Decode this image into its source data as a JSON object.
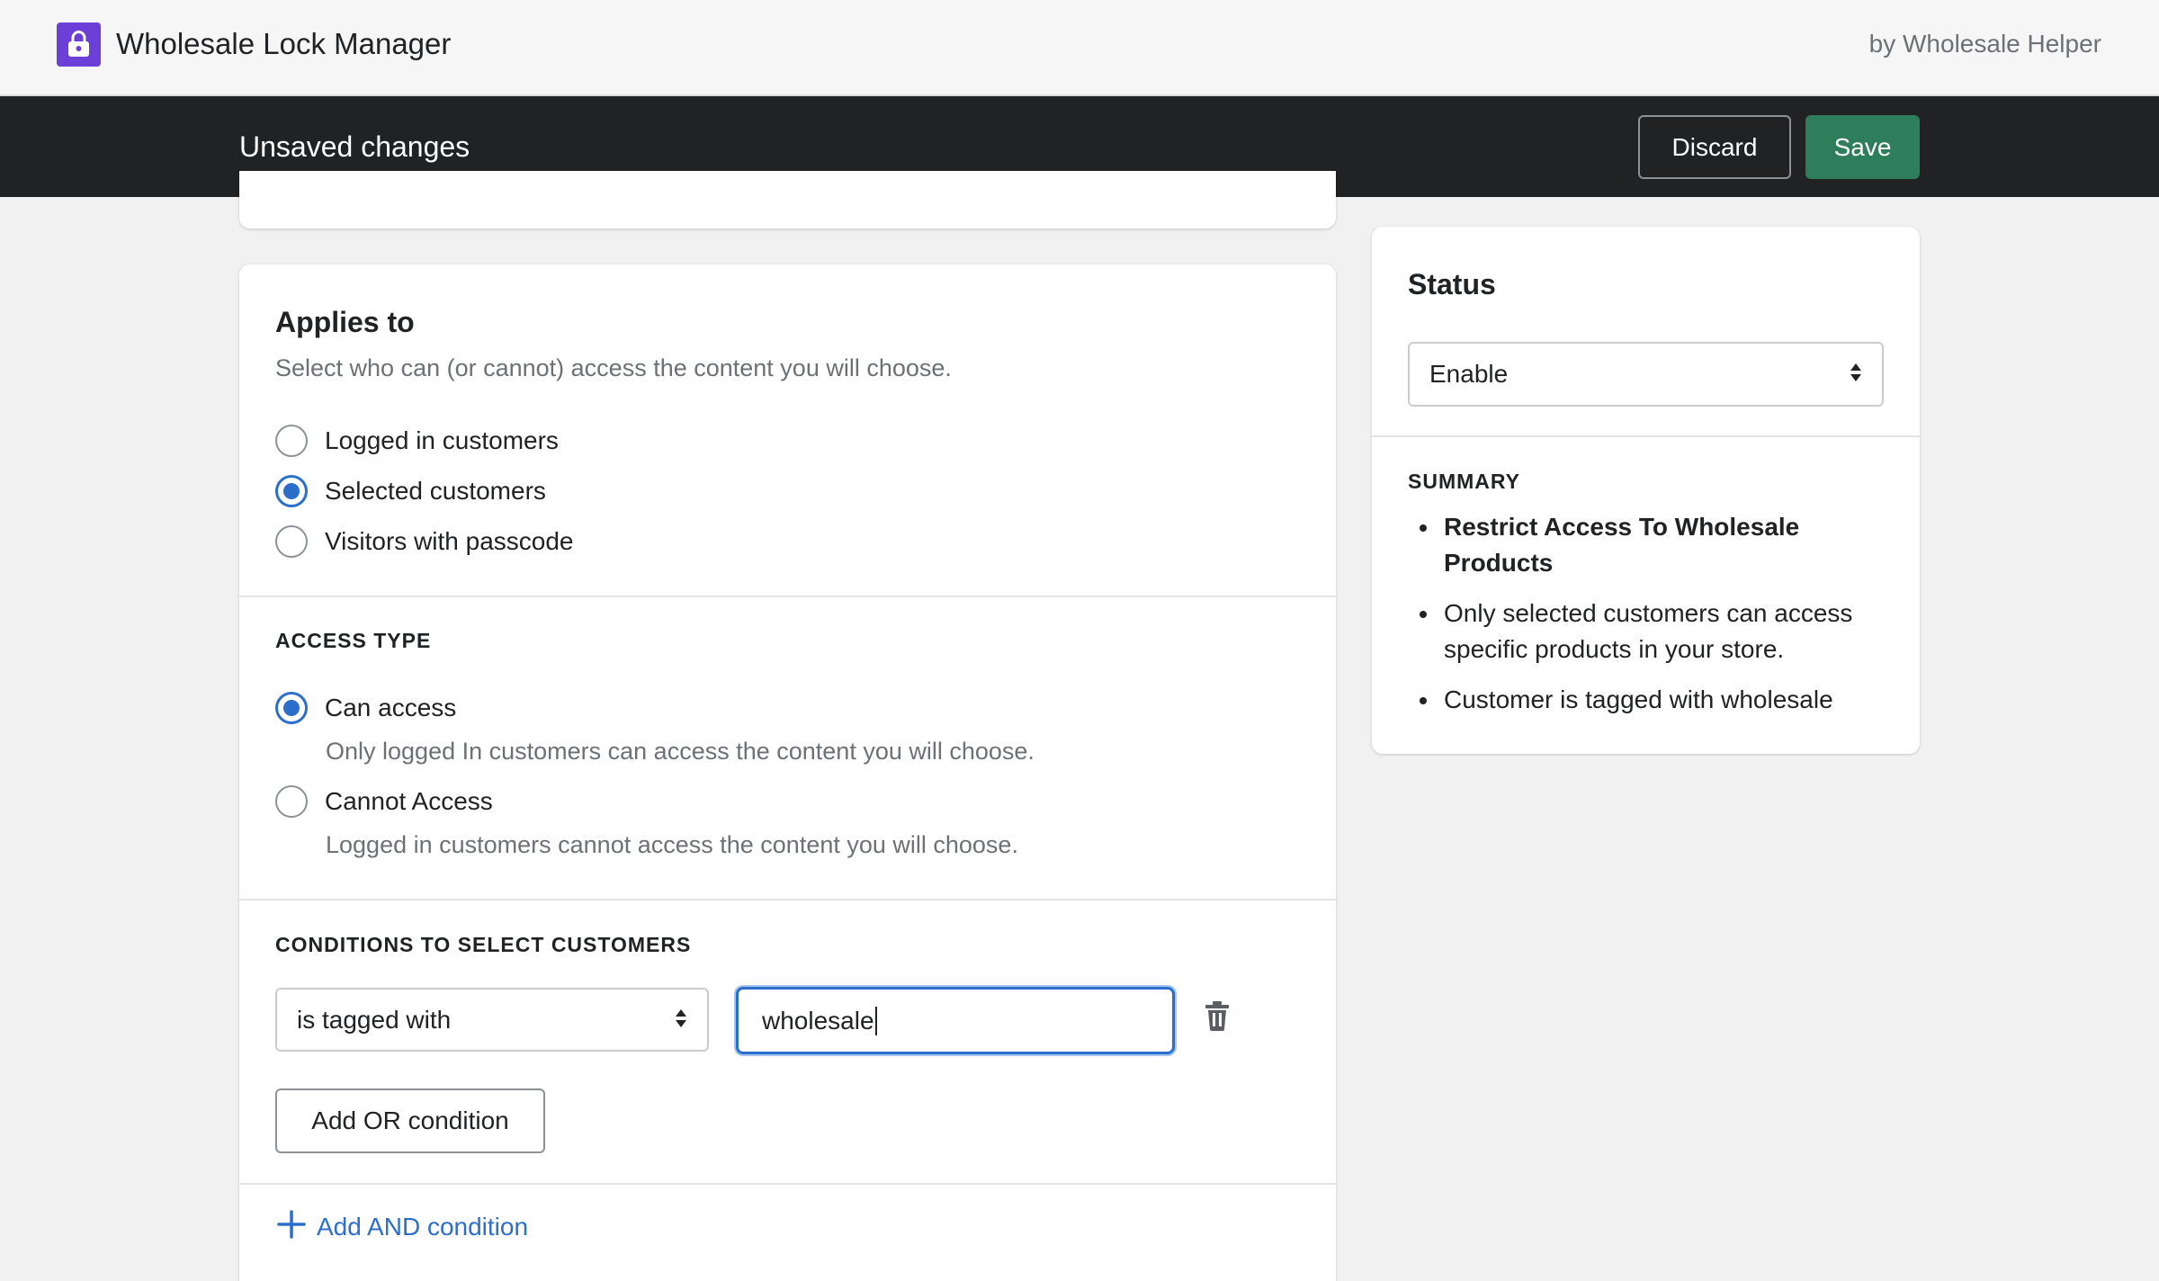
{
  "app": {
    "title": "Wholesale Lock Manager",
    "by": "by Wholesale Helper",
    "logo_icon": "lock-icon",
    "logo_color": "#6b3fd8"
  },
  "save_bar": {
    "title": "Unsaved changes",
    "discard_label": "Discard",
    "save_label": "Save",
    "save_color": "#2e7d5b"
  },
  "applies_to": {
    "heading": "Applies to",
    "description": "Select who can (or cannot) access the content you will choose.",
    "options": [
      {
        "label": "Logged in customers",
        "checked": false
      },
      {
        "label": "Selected customers",
        "checked": true
      },
      {
        "label": "Visitors with passcode",
        "checked": false
      }
    ]
  },
  "access_type": {
    "heading": "ACCESS TYPE",
    "options": [
      {
        "label": "Can access",
        "help": "Only logged In customers can access the content you will choose.",
        "checked": true
      },
      {
        "label": "Cannot Access",
        "help": "Logged in customers cannot access the content you will choose.",
        "checked": false
      }
    ]
  },
  "conditions": {
    "heading": "CONDITIONS TO SELECT CUSTOMERS",
    "condition_select_value": "is tagged with",
    "condition_value": "wholesale",
    "add_or_label": "Add OR condition",
    "add_and_label": "Add AND condition"
  },
  "status": {
    "heading": "Status",
    "select_value": "Enable",
    "summary_heading": "SUMMARY",
    "summary_items": [
      "Restrict Access To Wholesale Products",
      "Only selected customers can access specific products in your store.",
      "Customer is tagged with wholesale"
    ]
  },
  "colors": {
    "accent": "#2c6ecb",
    "dark_bar": "#202223"
  }
}
